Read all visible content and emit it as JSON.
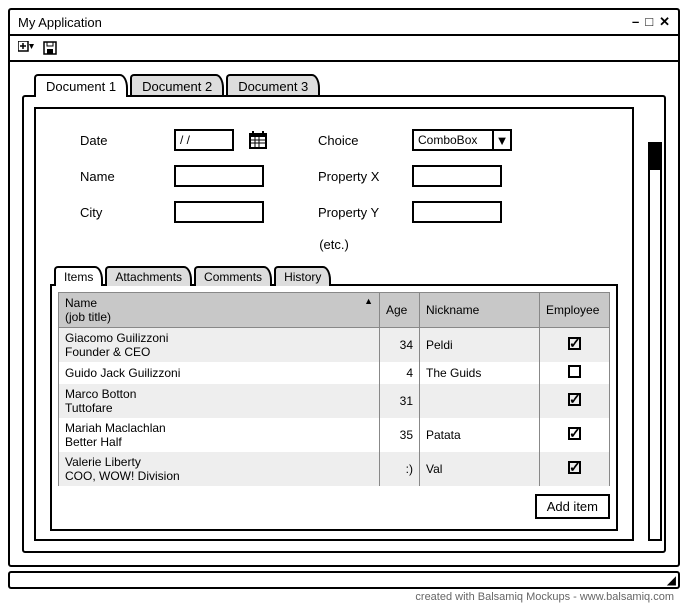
{
  "window": {
    "title": "My Application"
  },
  "toolbar": {},
  "documentTabs": [
    {
      "label": "Document 1",
      "active": true
    },
    {
      "label": "Document 2",
      "active": false
    },
    {
      "label": "Document 3",
      "active": false
    }
  ],
  "form": {
    "left": {
      "date": {
        "label": "Date",
        "value": "/ /"
      },
      "name": {
        "label": "Name",
        "value": ""
      },
      "city": {
        "label": "City",
        "value": ""
      }
    },
    "right": {
      "choice": {
        "label": "Choice",
        "value": "ComboBox"
      },
      "propX": {
        "label": "Property X",
        "value": ""
      },
      "propY": {
        "label": "Property Y",
        "value": ""
      }
    },
    "etc": "(etc.)"
  },
  "detailTabs": [
    {
      "label": "Items",
      "active": true
    },
    {
      "label": "Attachments",
      "active": false
    },
    {
      "label": "Comments",
      "active": false
    },
    {
      "label": "History",
      "active": false
    }
  ],
  "grid": {
    "headers": {
      "name": "Name",
      "nameSub": "(job title)",
      "age": "Age",
      "nickname": "Nickname",
      "employee": "Employee"
    },
    "rows": [
      {
        "name": "Giacomo Guilizzoni",
        "title": "Founder & CEO",
        "age": "34",
        "nickname": "Peldi",
        "employee": true
      },
      {
        "name": "Guido Jack Guilizzoni",
        "title": "",
        "age": "4",
        "nickname": "The Guids",
        "employee": false
      },
      {
        "name": "Marco Botton",
        "title": "Tuttofare",
        "age": "31",
        "nickname": "",
        "employee": true
      },
      {
        "name": "Mariah Maclachlan",
        "title": "Better Half",
        "age": "35",
        "nickname": "Patata",
        "employee": true
      },
      {
        "name": "Valerie Liberty",
        "title": "COO, WOW! Division",
        "age": ":)",
        "nickname": "Val",
        "employee": true
      }
    ],
    "addButton": "Add item"
  },
  "footer": "created with Balsamiq Mockups - www.balsamiq.com"
}
